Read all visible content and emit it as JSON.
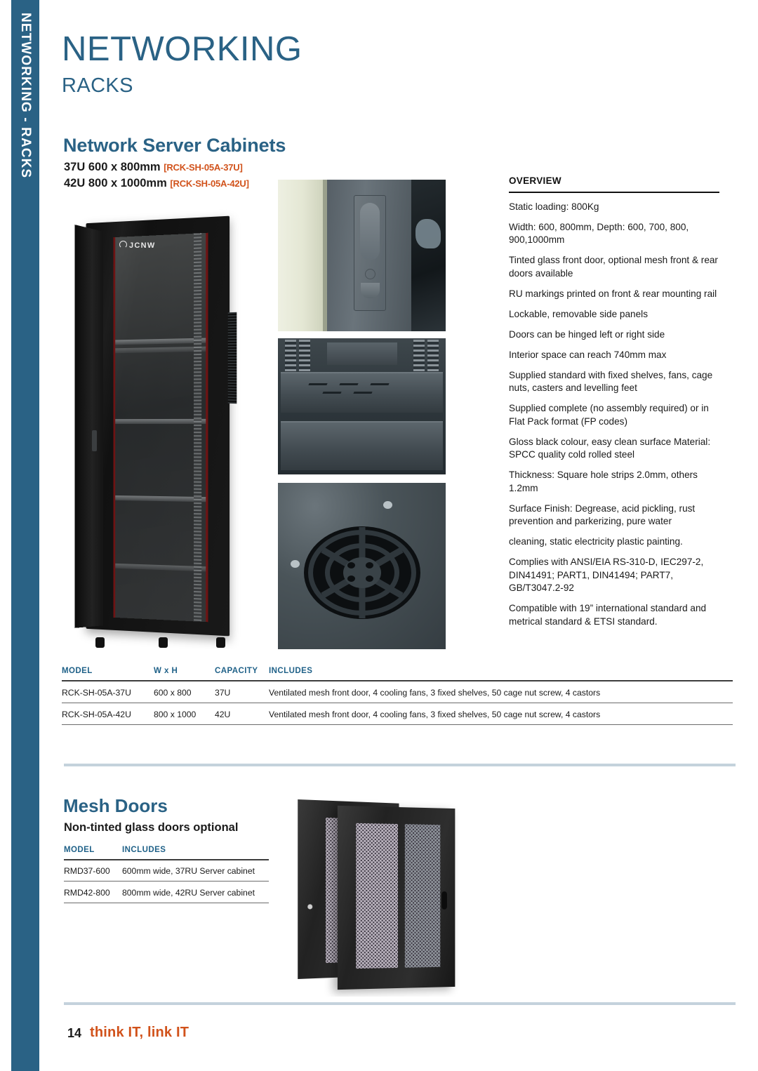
{
  "sidebar": {
    "label": "NETWORKING - RACKS",
    "color": "#2a6285"
  },
  "header": {
    "category": "NETWORKING",
    "subcategory": "RACKS"
  },
  "product": {
    "title": "Network Server Cabinets",
    "variants": [
      {
        "size": "37U 600 x 800mm",
        "code": "[RCK-SH-05A-37U]"
      },
      {
        "size": "42U 800 x 1000mm",
        "code": "[RCK-SH-05A-42U]"
      }
    ]
  },
  "overview": {
    "title": "OVERVIEW",
    "items": [
      "Static loading: 800Kg",
      "Width: 600, 800mm, Depth: 600, 700, 800, 900,1000mm",
      "Tinted glass front door, optional mesh front & rear doors available",
      "RU markings printed on front & rear mounting rail",
      "Lockable, removable side panels",
      "Doors can be hinged left or right side",
      "Interior space can reach 740mm max",
      "Supplied standard with fixed shelves, fans, cage nuts, casters and levelling feet",
      "Supplied complete (no assembly required) or in Flat Pack format (FP codes)",
      "Gloss black colour, easy clean surface Material: SPCC quality cold rolled steel",
      "Thickness: Square hole strips 2.0mm, others 1.2mm",
      "Surface Finish: Degrease, acid pickling, rust prevention and parkerizing, pure water",
      "cleaning, static electricity plastic painting.",
      "Complies with ANSI/EIA RS-310-D, IEC297-2, DIN41491; PART1, DIN41494; PART7, GB/T3047.2-92",
      "Compatible with 19” international standard and metrical standard & ETSI standard."
    ]
  },
  "main_table": {
    "headers": [
      "MODEL",
      "W x H",
      "CAPACITY",
      "INCLUDES"
    ],
    "rows": [
      {
        "model": "RCK-SH-05A-37U",
        "wxh": "600 x 800",
        "capacity": "37U",
        "includes": "Ventilated mesh front door, 4 cooling fans, 3 fixed shelves, 50 cage nut screw, 4 castors"
      },
      {
        "model": "RCK-SH-05A-42U",
        "wxh": "800 x 1000",
        "capacity": "42U",
        "includes": "Ventilated mesh front door, 4 cooling fans, 3 fixed shelves, 50 cage nut screw, 4 castors"
      }
    ]
  },
  "mesh_section": {
    "title": "Mesh Doors",
    "subtitle": "Non-tinted glass doors optional",
    "table": {
      "headers": [
        "MODEL",
        "INCLUDES"
      ],
      "rows": [
        {
          "model": "RMD37-600",
          "includes": "600mm wide, 37RU Server cabinet"
        },
        {
          "model": "RMD42-800",
          "includes": "800mm wide, 42RU Server cabinet"
        }
      ]
    }
  },
  "images": {
    "cabinet_logo": "JCNW",
    "cabinet_alt": "server-cabinet-photo",
    "lock_alt": "door-lock-photo",
    "shelf_alt": "interior-shelf-photo",
    "fan_alt": "fan-grille-photo",
    "mesh_doors_alt": "mesh-doors-photo"
  },
  "footer": {
    "page_number": "14",
    "tagline": "think IT, link IT"
  }
}
